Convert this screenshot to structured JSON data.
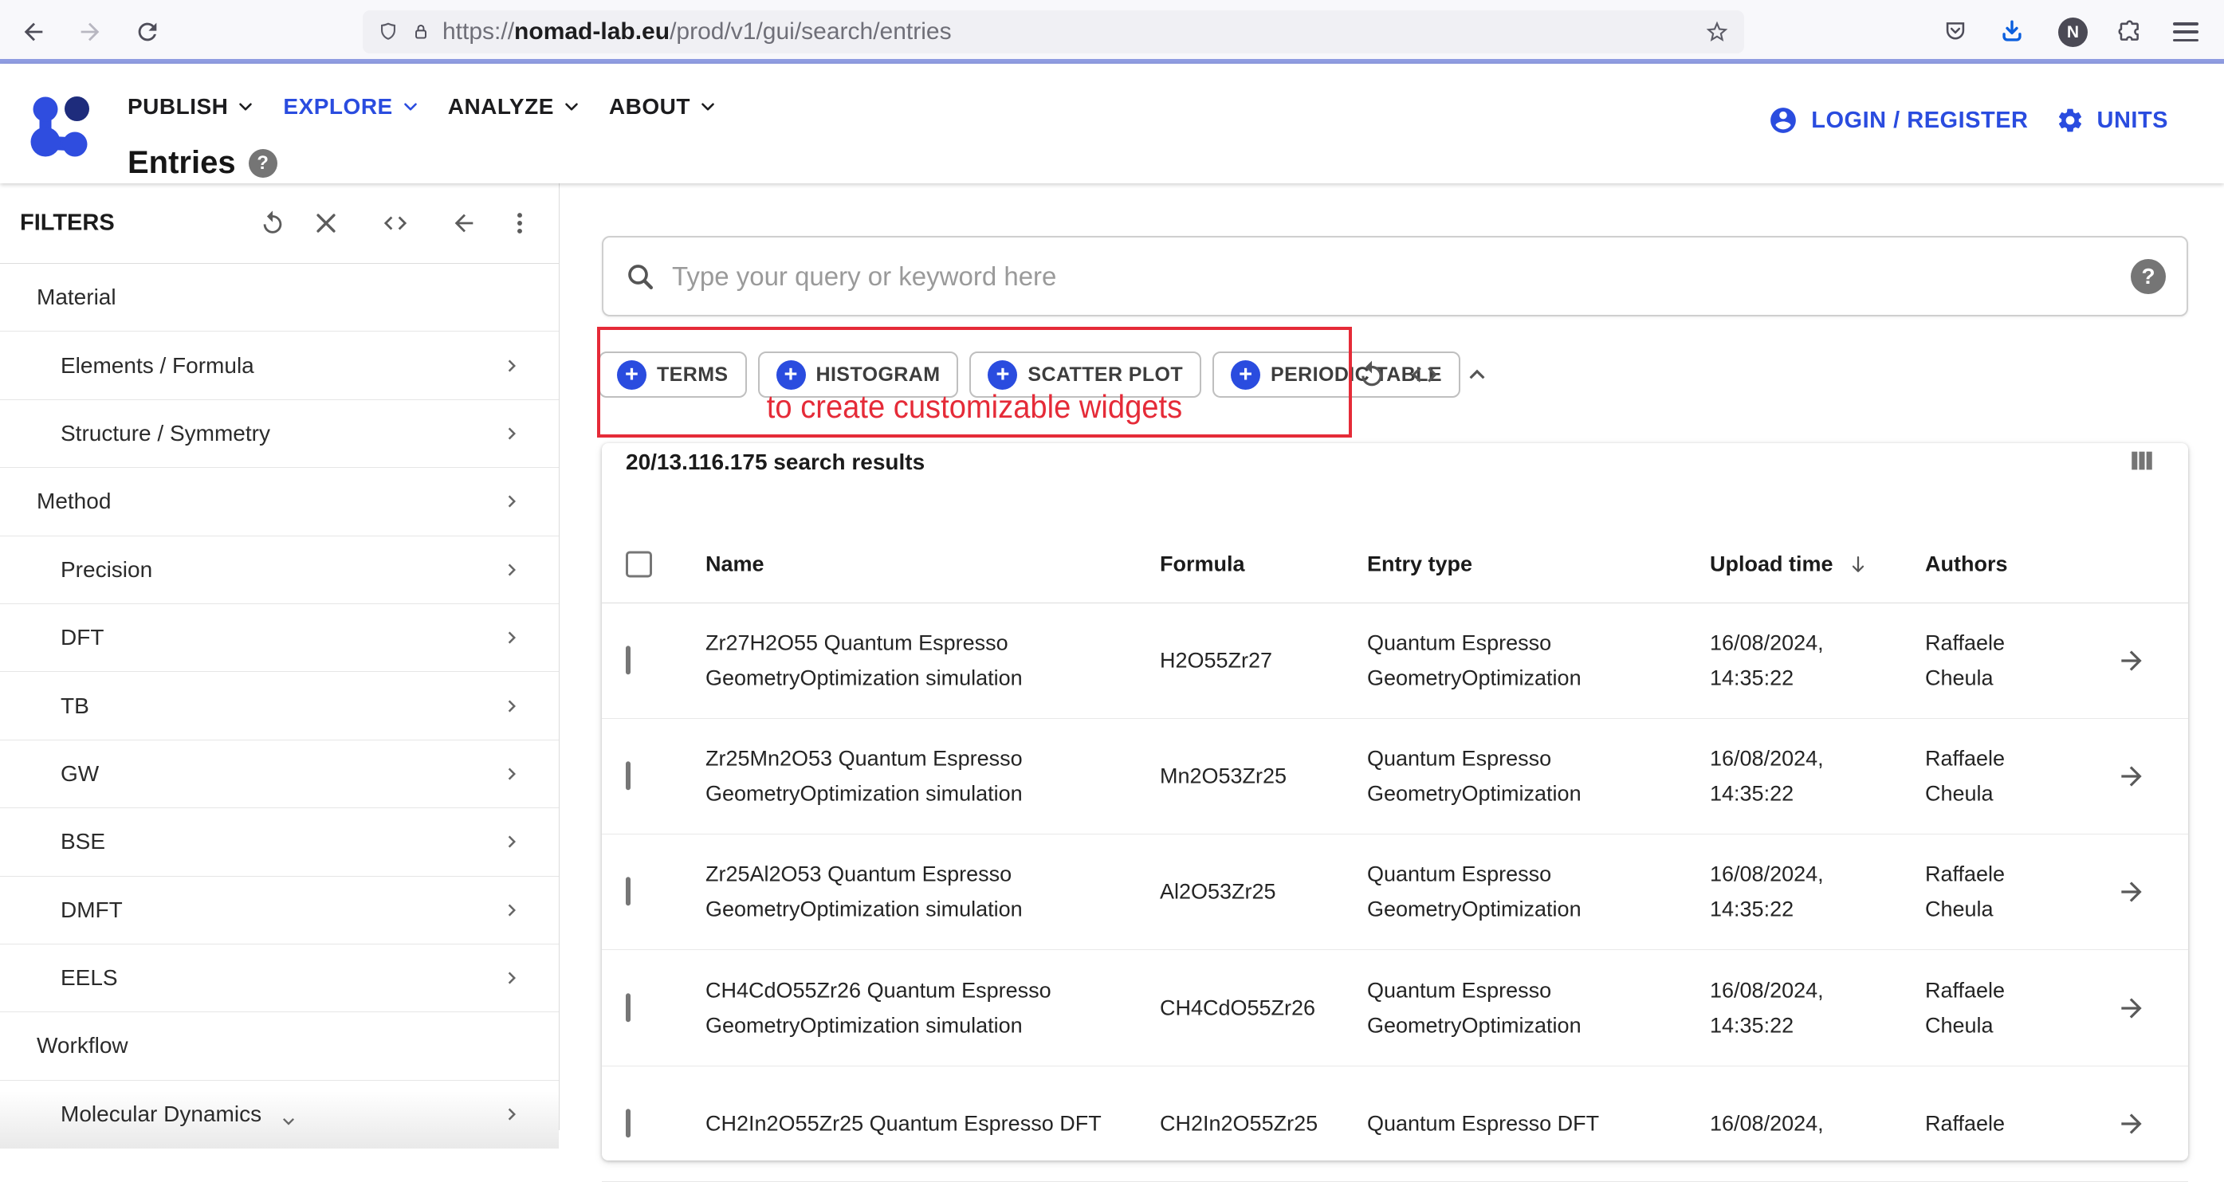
{
  "colors": {
    "accent": "#2a4cdf",
    "accent_dark": "#1e2c7c",
    "annotation_red": "#e52b38",
    "download_blue": "#0b5fde"
  },
  "icons": {
    "plus": "+",
    "help": "?",
    "toolbar": [
      "back-icon",
      "forward-icon",
      "reload-icon",
      "shield-icon",
      "lock-icon",
      "star-icon",
      "pocket-icon",
      "download-icon",
      "extensions-icon",
      "menu-icon"
    ],
    "filters": [
      "reset-icon",
      "close-icon",
      "code-icon",
      "arrow-left-icon",
      "more-vert-icon"
    ]
  },
  "browser": {
    "url": {
      "scheme": "https://",
      "domain": "nomad-lab.eu",
      "path": "/prod/v1/gui/search/entries"
    },
    "avatar_letter": "N"
  },
  "header": {
    "nav": [
      "PUBLISH",
      "EXPLORE",
      "ANALYZE",
      "ABOUT"
    ],
    "page_title": "Entries",
    "login_label": "LOGIN / REGISTER",
    "units_label": "UNITS"
  },
  "sidebar": {
    "title": "FILTERS",
    "items": [
      {
        "label": "Material",
        "indent": false,
        "chevron": false
      },
      {
        "label": "Elements / Formula",
        "indent": true,
        "chevron": true
      },
      {
        "label": "Structure / Symmetry",
        "indent": true,
        "chevron": true
      },
      {
        "label": "Method",
        "indent": false,
        "chevron": true
      },
      {
        "label": "Precision",
        "indent": true,
        "chevron": true
      },
      {
        "label": "DFT",
        "indent": true,
        "chevron": true
      },
      {
        "label": "TB",
        "indent": true,
        "chevron": true
      },
      {
        "label": "GW",
        "indent": true,
        "chevron": true
      },
      {
        "label": "BSE",
        "indent": true,
        "chevron": true
      },
      {
        "label": "DMFT",
        "indent": true,
        "chevron": true
      },
      {
        "label": "EELS",
        "indent": true,
        "chevron": true
      },
      {
        "label": "Workflow",
        "indent": false,
        "chevron": false
      },
      {
        "label": "Molecular Dynamics",
        "indent": true,
        "chevron": true,
        "dropdown": true
      }
    ]
  },
  "search": {
    "placeholder": "Type your query or keyword here"
  },
  "widgets": {
    "buttons": [
      "TERMS",
      "HISTOGRAM",
      "SCATTER PLOT",
      "PERIODIC TABLE"
    ]
  },
  "annotation": {
    "text": "to create customizable widgets"
  },
  "results": {
    "count_text": "20/13.116.175 search results",
    "columns": [
      "Name",
      "Formula",
      "Entry type",
      "Upload time",
      "Authors"
    ],
    "rows": [
      {
        "name1": "Zr27H2O55 Quantum Espresso",
        "name2": "GeometryOptimization simulation",
        "formula": "H2O55Zr27",
        "type1": "Quantum Espresso",
        "type2": "GeometryOptimization",
        "date1": "16/08/2024,",
        "date2": "14:35:22",
        "author1": "Raffaele",
        "author2": "Cheula"
      },
      {
        "name1": "Zr25Mn2O53 Quantum Espresso",
        "name2": "GeometryOptimization simulation",
        "formula": "Mn2O53Zr25",
        "type1": "Quantum Espresso",
        "type2": "GeometryOptimization",
        "date1": "16/08/2024,",
        "date2": "14:35:22",
        "author1": "Raffaele",
        "author2": "Cheula"
      },
      {
        "name1": "Zr25Al2O53 Quantum Espresso",
        "name2": "GeometryOptimization simulation",
        "formula": "Al2O53Zr25",
        "type1": "Quantum Espresso",
        "type2": "GeometryOptimization",
        "date1": "16/08/2024,",
        "date2": "14:35:22",
        "author1": "Raffaele",
        "author2": "Cheula"
      },
      {
        "name1": "CH4CdO55Zr26 Quantum Espresso",
        "name2": "GeometryOptimization simulation",
        "formula": "CH4CdO55Zr26",
        "type1": "Quantum Espresso",
        "type2": "GeometryOptimization",
        "date1": "16/08/2024,",
        "date2": "14:35:22",
        "author1": "Raffaele",
        "author2": "Cheula"
      },
      {
        "name1": "CH2In2O55Zr25 Quantum Espresso DFT",
        "name2": "",
        "formula": "CH2In2O55Zr25",
        "type1": "Quantum Espresso DFT",
        "type2": "",
        "date1": "16/08/2024,",
        "date2": "",
        "author1": "Raffaele",
        "author2": ""
      }
    ]
  }
}
